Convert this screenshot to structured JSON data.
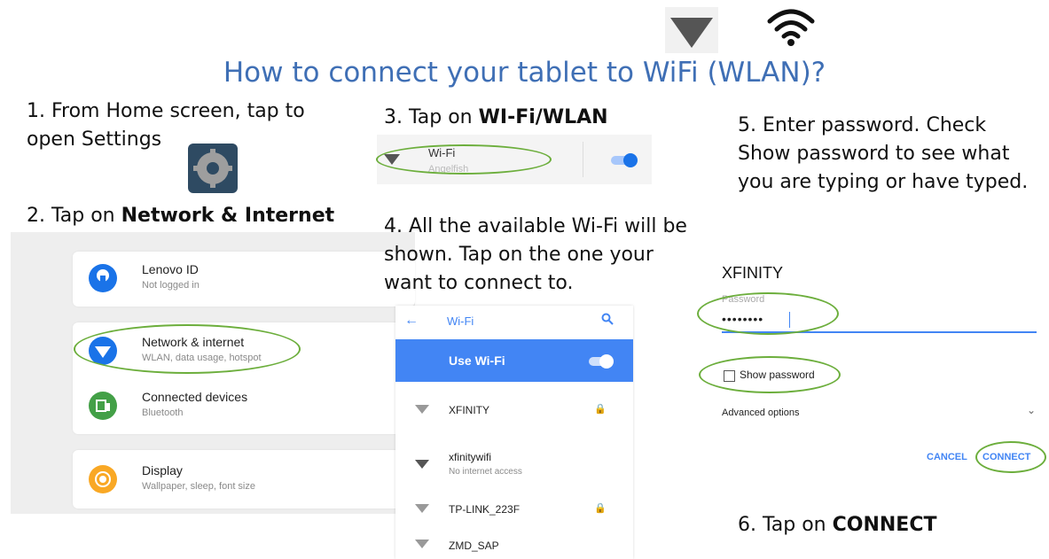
{
  "title": "How to connect your tablet to WiFi (WLAN)?",
  "header_icons": [
    "wifi-signal-triangle-icon",
    "wifi-arcs-icon"
  ],
  "steps": {
    "s1": "1. From Home screen,  tap to open Settings",
    "s2_prefix": "2. Tap on ",
    "s2_bold": "Network & Internet",
    "s3_prefix": "3. Tap on ",
    "s3_bold": "WI-Fi/WLAN",
    "s4": "4. All the available Wi-Fi will be shown. Tap on the one your want to connect to.",
    "s5": "5. Enter password. Check Show password to see what you are typing or have typed.",
    "s6_prefix": "6. Tap on ",
    "s6_bold": "CONNECT"
  },
  "settings": {
    "items": [
      {
        "title": "Lenovo ID",
        "subtitle": "Not logged in",
        "icon": "account-icon",
        "color": "#1a73e8"
      },
      {
        "title": "Network & internet",
        "subtitle": "WLAN, data usage, hotspot",
        "icon": "wifi-icon",
        "color": "#1a73e8"
      },
      {
        "title": "Connected devices",
        "subtitle": "Bluetooth",
        "icon": "devices-icon",
        "color": "#43a047"
      },
      {
        "title": "Display",
        "subtitle": "Wallpaper, sleep, font size",
        "icon": "brightness-icon",
        "color": "#f9a825"
      }
    ]
  },
  "wifi_toggle": {
    "label": "Wi-Fi",
    "sub": "Angelfish",
    "on": true
  },
  "wifi_list": {
    "back_icon": "back-arrow-icon",
    "header": "Wi-Fi",
    "search_icon": "search-icon",
    "use_label": "Use Wi-Fi",
    "use_on": true,
    "networks": [
      {
        "name": "XFINITY",
        "sub": "",
        "locked": true
      },
      {
        "name": "xfinitywifi",
        "sub": "No internet access",
        "locked": false
      },
      {
        "name": "TP-LINK_223F",
        "sub": "",
        "locked": true
      },
      {
        "name": "ZMD_SAP",
        "sub": "",
        "locked": false
      }
    ]
  },
  "dialog": {
    "network": "XFINITY",
    "password_label": "Password",
    "password_value": "••••••••",
    "show_password": "Show password",
    "show_password_checked": false,
    "advanced": "Advanced options",
    "cancel": "CANCEL",
    "connect": "CONNECT"
  },
  "colors": {
    "title": "#3f6fb5",
    "highlight": "#6cae3c",
    "accent": "#4285f4"
  }
}
